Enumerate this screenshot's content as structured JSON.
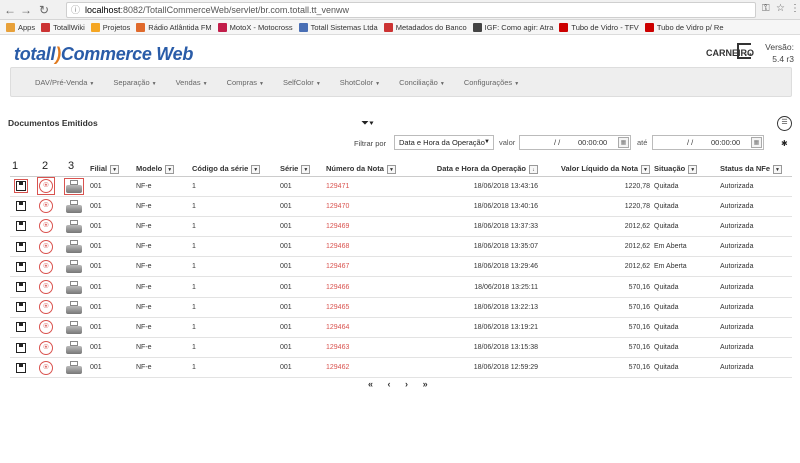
{
  "browser": {
    "url_host": "localhost",
    "url_rest": ":8082/TotallCommerceWeb/servlet/br.com.totall.tt_venww",
    "bookmarks": [
      "Apps",
      "TotallWiki",
      "Projetos",
      "Rádio Atlântida FM",
      "MotoX - Motocross",
      "Totall Sistemas Ltda",
      "Metadados do Banco",
      "IGF: Como agir: Atra",
      "Tubo de Vidro - TFV",
      "Tubo de Vidro p/ Re"
    ],
    "bookmark_colors": [
      "#e8a13a",
      "#cc3333",
      "#f5a623",
      "#e06a2c",
      "#c21d4a",
      "#4a6fb5",
      "#cc3333",
      "#444444",
      "#cc0000",
      "#cc0000"
    ]
  },
  "app": {
    "logo_part1": "totall",
    "logo_swoosh": ")",
    "logo_part2": "Commerce Web",
    "user": "CARNEIRO",
    "version_label": "Versão:",
    "version": "5.4 r3"
  },
  "menu": [
    "DAV/Pré-Venda",
    "Separação",
    "Vendas",
    "Compras",
    "SelfColor",
    "ShotColor",
    "Conciliação",
    "Configurações"
  ],
  "section": {
    "title": "Documentos Emitidos",
    "filter_label": "Filtrar por",
    "filter_value": "Data e Hora da Operação",
    "valor_label": "valor",
    "ate_label": "até",
    "date_from": "/ /",
    "time_from": "00:00:00",
    "date_to": "/ /",
    "time_to": "00:00:00"
  },
  "column_numbers": [
    "1",
    "2",
    "3"
  ],
  "table": {
    "headers": [
      "Filial",
      "Modelo",
      "Código da série",
      "Série",
      "Número da Nota",
      "Data e Hora da Operação",
      "Valor Líquido da Nota",
      "Situação",
      "Status da NFe"
    ],
    "rows": [
      [
        "001",
        "NF-e",
        "1",
        "001",
        "129471",
        "18/06/2018 13:43:16",
        "1220,78",
        "Quitada",
        "Autorizada"
      ],
      [
        "001",
        "NF-e",
        "1",
        "001",
        "129470",
        "18/06/2018 13:40:16",
        "1220,78",
        "Quitada",
        "Autorizada"
      ],
      [
        "001",
        "NF-e",
        "1",
        "001",
        "129469",
        "18/06/2018 13:37:33",
        "2012,62",
        "Quitada",
        "Autorizada"
      ],
      [
        "001",
        "NF-e",
        "1",
        "001",
        "129468",
        "18/06/2018 13:35:07",
        "2012,62",
        "Em Aberta",
        "Autorizada"
      ],
      [
        "001",
        "NF-e",
        "1",
        "001",
        "129467",
        "18/06/2018 13:29:46",
        "2012,62",
        "Em Aberta",
        "Autorizada"
      ],
      [
        "001",
        "NF-e",
        "1",
        "001",
        "129466",
        "18/06/2018 13:25:11",
        "570,16",
        "Quitada",
        "Autorizada"
      ],
      [
        "001",
        "NF-e",
        "1",
        "001",
        "129465",
        "18/06/2018 13:22:13",
        "570,16",
        "Quitada",
        "Autorizada"
      ],
      [
        "001",
        "NF-e",
        "1",
        "001",
        "129464",
        "18/06/2018 13:19:21",
        "570,16",
        "Quitada",
        "Autorizada"
      ],
      [
        "001",
        "NF-e",
        "1",
        "001",
        "129463",
        "18/06/2018 13:15:38",
        "570,16",
        "Quitada",
        "Autorizada"
      ],
      [
        "001",
        "NF-e",
        "1",
        "001",
        "129462",
        "18/06/2018 12:59:29",
        "570,16",
        "Quitada",
        "Autorizada"
      ]
    ]
  },
  "pager": {
    "first": "«",
    "prev": "‹",
    "next": "›",
    "last": "»"
  }
}
